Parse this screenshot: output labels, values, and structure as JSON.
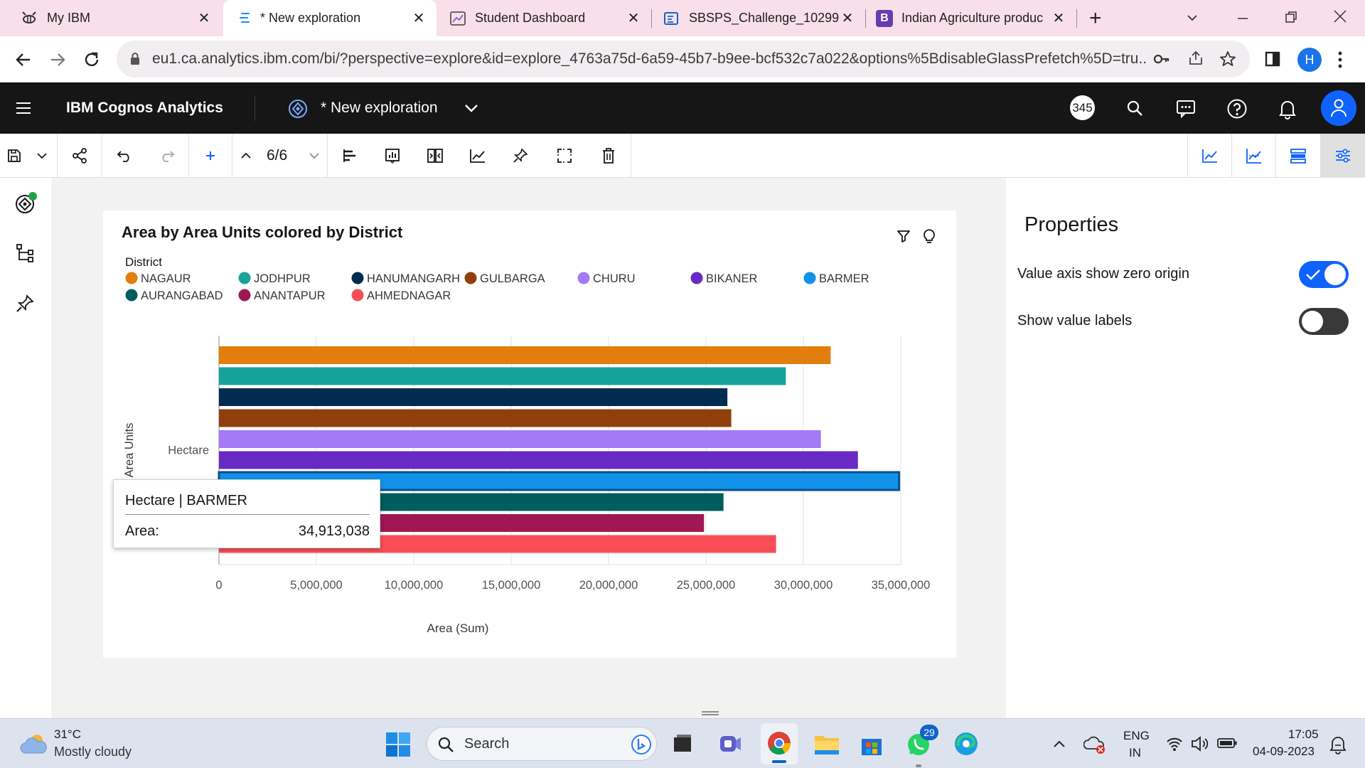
{
  "browser": {
    "tabs": [
      {
        "title": "My IBM",
        "active": false
      },
      {
        "title": "* New exploration",
        "active": true
      },
      {
        "title": "Student Dashboard",
        "active": false
      },
      {
        "title": "SBSPS_Challenge_10299",
        "active": false
      },
      {
        "title": "Indian Agriculture produc",
        "active": false
      }
    ],
    "url": "eu1.ca.analytics.ibm.com/bi/?perspective=explore&id=explore_4763a75d-6a59-45b7-b9ee-bcf532c7a022&options%5BdisableGlassPrefetch%5D=tru...",
    "profile_initial": "H"
  },
  "app": {
    "product": "IBM Cognos Analytics",
    "exploration_title": "* New exploration",
    "badge_count": "345"
  },
  "toolbar": {
    "page_indicator": "6/6"
  },
  "chart_data": {
    "type": "bar",
    "orientation": "horizontal",
    "title": "Area by Area Units colored by District",
    "legend_title": "District",
    "legend_placement": "top-left",
    "xlabel": "Area (Sum)",
    "ylabel": "Area Units",
    "categories": [
      "Hectare"
    ],
    "xlim": [
      0,
      35000000
    ],
    "x_ticks": [
      "0",
      "5,000,000",
      "10,000,000",
      "15,000,000",
      "20,000,000",
      "25,000,000",
      "30,000,000",
      "35,000,000"
    ],
    "grid": true,
    "series": [
      {
        "name": "NAGAUR",
        "value": 31400000,
        "color": "#e17e0d"
      },
      {
        "name": "JODHPUR",
        "value": 29100000,
        "color": "#17a39a"
      },
      {
        "name": "HANUMANGARH",
        "value": 26100000,
        "color": "#002d4f"
      },
      {
        "name": "GULBARGA",
        "value": 26300000,
        "color": "#8f3f0c"
      },
      {
        "name": "CHURU",
        "value": 30900000,
        "color": "#a679f7"
      },
      {
        "name": "BIKANER",
        "value": 32800000,
        "color": "#6929c4"
      },
      {
        "name": "BARMER",
        "value": 34913038,
        "color": "#1192e8",
        "highlighted": true
      },
      {
        "name": "AURANGABAD",
        "value": 25900000,
        "color": "#005d5d"
      },
      {
        "name": "ANANTAPUR",
        "value": 24900000,
        "color": "#9f1853"
      },
      {
        "name": "AHMEDNAGAR",
        "value": 28600000,
        "color": "#fa4d56"
      }
    ],
    "tooltip": {
      "header": "Hectare | BARMER",
      "label": "Area:",
      "value": "34,913,038"
    }
  },
  "properties": {
    "title": "Properties",
    "options": [
      {
        "label": "Value axis show zero origin",
        "on": true
      },
      {
        "label": "Show value labels",
        "on": false
      }
    ]
  },
  "taskbar": {
    "weather_temp": "31°C",
    "weather_desc": "Mostly cloudy",
    "search_placeholder": "Search",
    "whatsapp_badge": "29",
    "lang_primary": "ENG",
    "lang_secondary": "IN",
    "time": "17:05",
    "date": "04-09-2023"
  }
}
